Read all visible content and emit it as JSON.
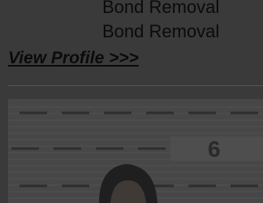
{
  "lines": [
    "Bond Removal",
    "Bond Removal"
  ],
  "profile_link": "View Profile >>>",
  "mugshot": {
    "height_marker": "6",
    "background_color": "#474747"
  }
}
